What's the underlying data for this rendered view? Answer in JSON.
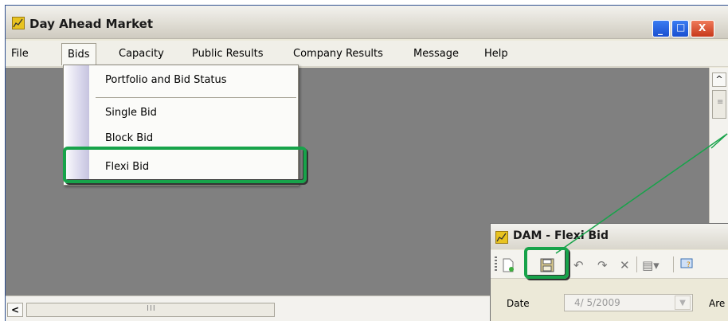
{
  "window": {
    "title": "Day Ahead Market",
    "controls": {
      "minimize": "_",
      "maximize": "□",
      "close": "X"
    }
  },
  "menubar": {
    "items": [
      "File",
      "Bids",
      "Capacity",
      "Public Results",
      "Company Results",
      "Message",
      "Help"
    ],
    "active": "Bids"
  },
  "bids_menu": {
    "items": [
      "Portfolio and Bid Status",
      "Single Bid",
      "Block Bid",
      "Flexi Bid"
    ],
    "highlighted": "Flexi Bid"
  },
  "scrollbars": {
    "up_arrow": "^",
    "left_arrow": "<",
    "grip": "III"
  },
  "child_window": {
    "title": "DAM - Flexi Bid",
    "toolbar_icons": [
      "new-icon",
      "save-icon",
      "undo-icon",
      "redo-icon",
      "delete-icon",
      "copy-icon",
      "help-icon"
    ],
    "date_label": "Date",
    "date_value": "4/ 5/2009",
    "area_label": "Are"
  },
  "colors": {
    "highlight": "#17a34a",
    "mdi_background": "#808080",
    "titlebar_blue": "#1a4fd0"
  }
}
